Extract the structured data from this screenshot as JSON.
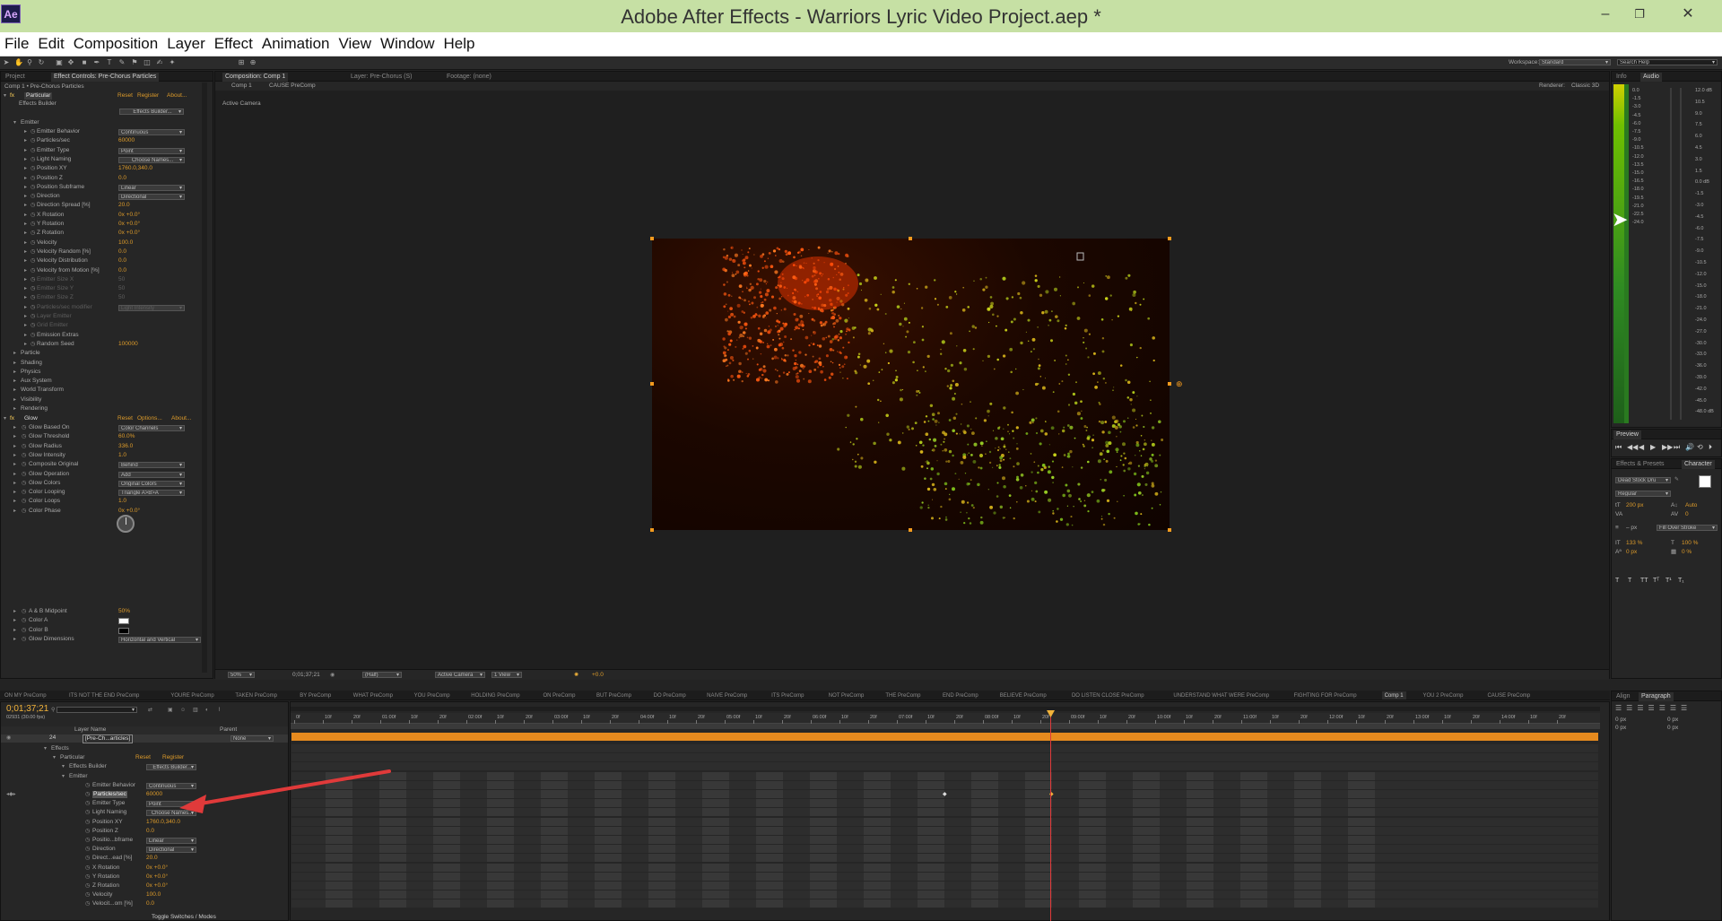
{
  "window": {
    "logo": "Ae",
    "title": "Adobe After Effects - Warriors Lyric Video Project.aep *",
    "minimize": "–",
    "maximize": "❐",
    "close": "✕"
  },
  "menu": [
    "File",
    "Edit",
    "Composition",
    "Layer",
    "Effect",
    "Animation",
    "View",
    "Window",
    "Help"
  ],
  "toolbar": {
    "workspace_label": "Workspace:",
    "workspace_value": "Standard",
    "search_placeholder": "Search Help"
  },
  "effect_controls": {
    "tabs": [
      "Project",
      "Effect Controls: Pre-Chorus Particles"
    ],
    "header": "Comp 1 • Pre-Chorus Particles",
    "particular": {
      "name": "Particular",
      "links": [
        "Reset",
        "Register",
        "About..."
      ],
      "effects_builder_label": "Effects Builder",
      "effects_builder_btn": "Effects Builder...",
      "emitter_label": "Emitter",
      "rows": [
        {
          "label": "Emitter Behavior",
          "dd": "Continuous"
        },
        {
          "label": "Particles/sec",
          "val": "60000"
        },
        {
          "label": "Emitter Type",
          "dd": "Point"
        },
        {
          "label": "Light Naming",
          "btn": "Choose Names..."
        },
        {
          "label": "Position XY",
          "val": "1760.0,340.0"
        },
        {
          "label": "Position Z",
          "val": "0.0"
        },
        {
          "label": "Position Subframe",
          "dd": "Linear"
        },
        {
          "label": "Direction",
          "dd": "Directional"
        },
        {
          "label": "Direction Spread [%]",
          "val": "20.0"
        },
        {
          "label": "X Rotation",
          "val": "0x +0.0°"
        },
        {
          "label": "Y Rotation",
          "val": "0x +0.0°"
        },
        {
          "label": "Z Rotation",
          "val": "0x +0.0°"
        },
        {
          "label": "Velocity",
          "val": "100.0"
        },
        {
          "label": "Velocity Random [%]",
          "val": "0.0"
        },
        {
          "label": "Velocity Distribution",
          "val": "0.0"
        },
        {
          "label": "Velocity from Motion [%]",
          "val": "0.0"
        },
        {
          "label": "Emitter Size X",
          "val": "50",
          "disabled": true
        },
        {
          "label": "Emitter Size Y",
          "val": "50",
          "disabled": true
        },
        {
          "label": "Emitter Size Z",
          "val": "50",
          "disabled": true
        },
        {
          "label": "Particles/sec modifier",
          "dd": "Light Intensity",
          "disabled": true
        },
        {
          "label": "Layer Emitter",
          "disabled": true
        },
        {
          "label": "Grid Emitter",
          "disabled": true
        },
        {
          "label": "Emission Extras"
        },
        {
          "label": "Random Seed",
          "val": "100000"
        }
      ],
      "groups": [
        "Particle",
        "Shading",
        "Physics",
        "Aux System",
        "World Transform",
        "Visibility",
        "Rendering"
      ]
    },
    "glow": {
      "name": "Glow",
      "links": [
        "Reset",
        "Options...",
        "About..."
      ],
      "rows": [
        {
          "label": "Glow Based On",
          "dd": "Color Channels"
        },
        {
          "label": "Glow Threshold",
          "val": "60.0%"
        },
        {
          "label": "Glow Radius",
          "val": "336.0"
        },
        {
          "label": "Glow Intensity",
          "val": "1.0"
        },
        {
          "label": "Composite Original",
          "dd": "Behind"
        },
        {
          "label": "Glow Operation",
          "dd": "Add"
        },
        {
          "label": "Glow Colors",
          "dd": "Original Colors"
        },
        {
          "label": "Color Looping",
          "dd": "Triangle A>B>A"
        },
        {
          "label": "Color Loops",
          "val": "1.0"
        },
        {
          "label": "Color Phase",
          "val": "0x +0.0°"
        }
      ],
      "rows2": [
        {
          "label": "A & B Midpoint",
          "val": "50%"
        },
        {
          "label": "Color A"
        },
        {
          "label": "Color B"
        },
        {
          "label": "Glow Dimensions",
          "dd": "Horizontal and Vertical"
        }
      ]
    }
  },
  "composition": {
    "tabs": [
      "Composition: Comp 1",
      "Layer: Pre-Chorus (S)",
      "Footage: (none)"
    ],
    "breadcrumbs": [
      "Comp 1",
      "CAUSE PreComp"
    ],
    "renderer_label": "Renderer:",
    "renderer_value": "Classic 3D",
    "camera_label": "Active Camera",
    "footer": {
      "zoom": "50%",
      "time": "0;01;37;21",
      "resolution": "(Half)",
      "camera": "Active Camera",
      "view": "1 View",
      "exposure": "+0.0"
    }
  },
  "info_panel": {
    "tabs": [
      "Info",
      "Audio"
    ],
    "db_left": [
      "0.0",
      "-1.5",
      "-3.0",
      "-4.5",
      "-6.0",
      "-7.5",
      "-9.0",
      "-10.5",
      "-12.0",
      "-13.5",
      "-15.0",
      "-16.5",
      "-18.0",
      "-19.5",
      "-21.0",
      "-22.5",
      "-24.0"
    ],
    "db_right": [
      "12.0 dB",
      "10.5",
      "9.0",
      "7.5",
      "6.0",
      "4.5",
      "3.0",
      "1.5",
      "0.0 dB",
      "-1.5",
      "-3.0",
      "-4.5",
      "-6.0",
      "-7.5",
      "-9.0",
      "-10.5",
      "-12.0",
      "-15.0",
      "-18.0",
      "-21.0",
      "-24.0",
      "-27.0",
      "-30.0",
      "-33.0",
      "-36.0",
      "-39.0",
      "-42.0",
      "-45.0",
      "-48.0 dB"
    ]
  },
  "preview_panel": {
    "tab": "Preview",
    "controls": [
      "⏮",
      "◀◀",
      "◀",
      "▶",
      "▶▶",
      "⏭",
      "🔊",
      "⟲",
      "⏵"
    ]
  },
  "character_panel": {
    "tabs": [
      "Effects & Presets",
      "Character"
    ],
    "font": "Dead Stock Dru",
    "style": "Regular",
    "size": "200 px",
    "leading": "Auto",
    "tracking": "0",
    "stroke_width": "– px",
    "stroke_type": "Fill Over Stroke",
    "v_scale": "133 %",
    "h_scale": "100 %",
    "baseline": "0 px",
    "tsume": "0 %",
    "buttons": [
      "T",
      "T",
      "TT",
      "Tᵀ",
      "T¹",
      "T₁"
    ]
  },
  "paragraph_panel": {
    "tabs": [
      "Align",
      "Paragraph"
    ],
    "values": [
      "0 px",
      "0 px",
      "0 px",
      "0 px",
      "0 px"
    ]
  },
  "timeline": {
    "tabs": [
      "ON MY PreComp",
      "ITS NOT THE END PreComp",
      "YOURE PreComp",
      "TAKEN PreComp",
      "BY PreComp",
      "WHAT PreComp",
      "YOU PreComp",
      "HOLDING PreComp",
      "ON PreComp",
      "BUT PreComp",
      "DO PreComp",
      "NAIVE PreComp",
      "ITS PreComp",
      "NOT PreComp",
      "THE PreComp",
      "END PreComp",
      "BELIEVE PreComp",
      "DO LISTEN CLOSE PreComp",
      "UNDERSTAND WHAT WERE PreComp",
      "FIGHTING FOR PreComp",
      "Comp 1",
      "YOU 2 PreComp",
      "CAUSE PreComp"
    ],
    "active_tab": "Comp 1",
    "timecode": "0;01;37;21",
    "frames": "02931 (30.00 fps)",
    "search_placeholder": "",
    "col_headers": {
      "layer_name": "Layer Name",
      "parent": "Parent"
    },
    "layer": {
      "num": "24",
      "name": "[Pre-Ch...articles]",
      "parent": "None"
    },
    "rows": [
      {
        "label": "Effects",
        "indent": 0
      },
      {
        "label": "Particular",
        "indent": 1,
        "links": [
          "Reset",
          "Register"
        ]
      },
      {
        "label": "Effects Builder",
        "indent": 2,
        "btn": "Effects Builder..."
      },
      {
        "label": "Emitter",
        "indent": 2
      },
      {
        "label": "Emitter Behavior",
        "indent": 3,
        "dd": "Continuous"
      },
      {
        "label": "Particles/sec",
        "indent": 3,
        "val": "60000",
        "highlight": true
      },
      {
        "label": "Emitter Type",
        "indent": 3,
        "dd": "Point"
      },
      {
        "label": "Light Naming",
        "indent": 3,
        "btn": "Choose Names..."
      },
      {
        "label": "Position XY",
        "indent": 3,
        "val": "1760.0,340.0"
      },
      {
        "label": "Position Z",
        "indent": 3,
        "val": "0.0"
      },
      {
        "label": "Positio...bframe",
        "indent": 3,
        "dd": "Linear"
      },
      {
        "label": "Direction",
        "indent": 3,
        "dd": "Directional"
      },
      {
        "label": "Direct...ead [%]",
        "indent": 3,
        "val": "20.0"
      },
      {
        "label": "X Rotation",
        "indent": 3,
        "val": "0x +0.0°"
      },
      {
        "label": "Y Rotation",
        "indent": 3,
        "val": "0x +0.0°"
      },
      {
        "label": "Z Rotation",
        "indent": 3,
        "val": "0x +0.0°"
      },
      {
        "label": "Velocity",
        "indent": 3,
        "val": "100.0"
      },
      {
        "label": "Velocit...om [%]",
        "indent": 3,
        "val": "0.0"
      }
    ],
    "ruler": [
      "0f",
      "10f",
      "20f",
      "01:00f",
      "10f",
      "20f",
      "02:00f",
      "10f",
      "20f",
      "03:00f",
      "10f",
      "20f",
      "04:00f",
      "10f",
      "20f",
      "05:00f",
      "10f",
      "20f",
      "06:00f",
      "10f",
      "20f",
      "07:00f",
      "10f",
      "20f",
      "08:00f",
      "10f",
      "20f",
      "09:00f",
      "10f",
      "20f",
      "10:00f",
      "10f",
      "20f",
      "11:00f",
      "10f",
      "20f",
      "12:00f",
      "10f",
      "20f",
      "13:00f",
      "10f",
      "20f",
      "14:00f",
      "10f",
      "20f"
    ],
    "footer_toggle": "Toggle Switches / Modes"
  },
  "colors": {
    "titlebar": "#c6e0a4",
    "accent_orange": "#dd9b2a",
    "track": "#e68a1e",
    "arrow": "#e03a3a"
  }
}
